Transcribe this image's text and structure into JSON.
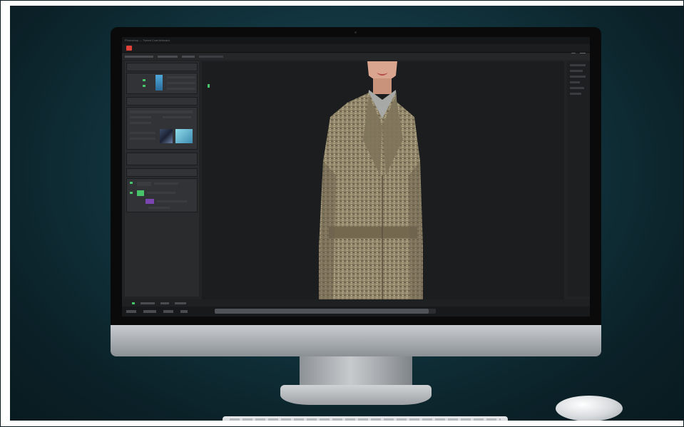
{
  "window": {
    "title": "Photoshop — Tweed Coat Artboard",
    "status_right": "",
    "top_status_text": ""
  },
  "menu": {
    "items": [
      "",
      "",
      "",
      "",
      "",
      "",
      "",
      "",
      "",
      "",
      ""
    ]
  },
  "icons": {
    "app": "app-logo-icon",
    "eye": "eye-icon",
    "layer-visible": "eye-icon"
  },
  "colors": {
    "accent": "#e0423a",
    "highlight": "#47c46a",
    "thumb_blue": "#4fa8d8",
    "thumb_purple": "#7b45b0"
  }
}
